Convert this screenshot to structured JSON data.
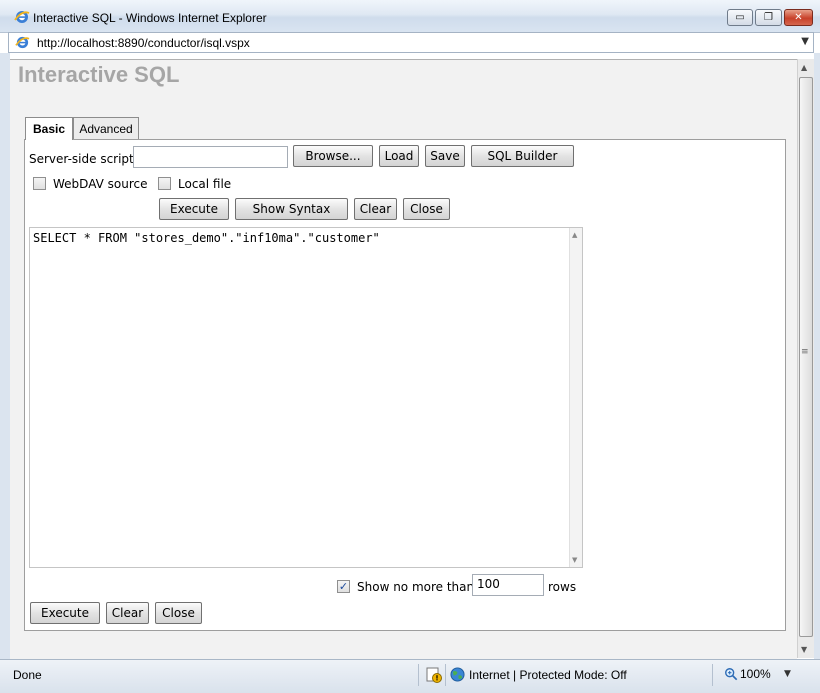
{
  "window": {
    "title": "Interactive SQL - Windows Internet Explorer",
    "minimize_glyph": "▭",
    "restore_glyph": "❐",
    "close_glyph": "✕"
  },
  "address_bar": {
    "url": "http://localhost:8890/conductor/isql.vspx",
    "dropdown_glyph": "▼"
  },
  "page": {
    "title": "Interactive SQL"
  },
  "tabs": [
    {
      "label": "Basic",
      "active": true
    },
    {
      "label": "Advanced",
      "active": false
    }
  ],
  "script_row": {
    "label": "Server-side script",
    "input_value": "",
    "browse_label": "Browse...",
    "load_label": "Load",
    "save_label": "Save",
    "builder_label": "SQL Builder"
  },
  "source_options": {
    "webdav_label": "WebDAV source",
    "webdav_checked": false,
    "local_label": "Local file",
    "local_checked": false
  },
  "top_actions": {
    "execute_label": "Execute",
    "syntax_label": "Show Syntax",
    "clear_label": "Clear",
    "close_label": "Close"
  },
  "sql_editor": {
    "text": "SELECT * FROM \"stores_demo\".\"inf10ma\".\"customer\""
  },
  "row_limit": {
    "checkbox_checked": true,
    "prefix_label": "Show no more than",
    "value": "100",
    "suffix_label": "rows"
  },
  "bottom_actions": {
    "execute_label": "Execute",
    "clear_label": "Clear",
    "close_label": "Close"
  },
  "status_bar": {
    "status": "Done",
    "zone": "Internet | Protected Mode: Off",
    "zoom": "100%",
    "zoom_dropdown_glyph": "▼"
  },
  "colors": {
    "page_title": "#a6a6a6",
    "checkbox_mark": "#1c4a9c"
  }
}
